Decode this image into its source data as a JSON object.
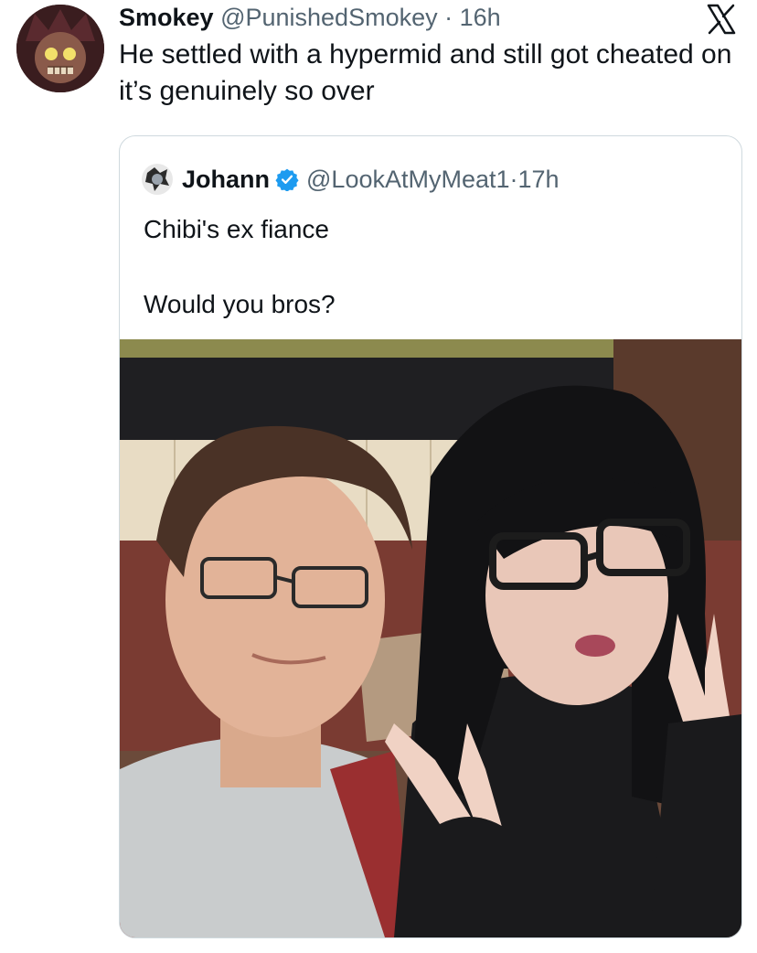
{
  "tweet": {
    "display_name": "Smokey",
    "handle": "@PunishedSmokey",
    "separator": "·",
    "time": "16h",
    "text": "He settled with a hypermid and still got cheated on it’s genuinely so over",
    "avatar_icon": "skull-character-avatar",
    "platform_icon": "x-logo-icon"
  },
  "quote": {
    "display_name": "Johann",
    "handle": "@LookAtMyMeat1",
    "separator": "·",
    "time": "17h",
    "verified_icon": "verified-badge-icon",
    "lines": [
      "Chibi's ex fiance",
      "Would you bros?"
    ],
    "photo": "selfie-photo"
  },
  "colors": {
    "text": "#0f1419",
    "muted": "#536471",
    "border": "#cfd9de",
    "verified": "#1d9bf0"
  }
}
